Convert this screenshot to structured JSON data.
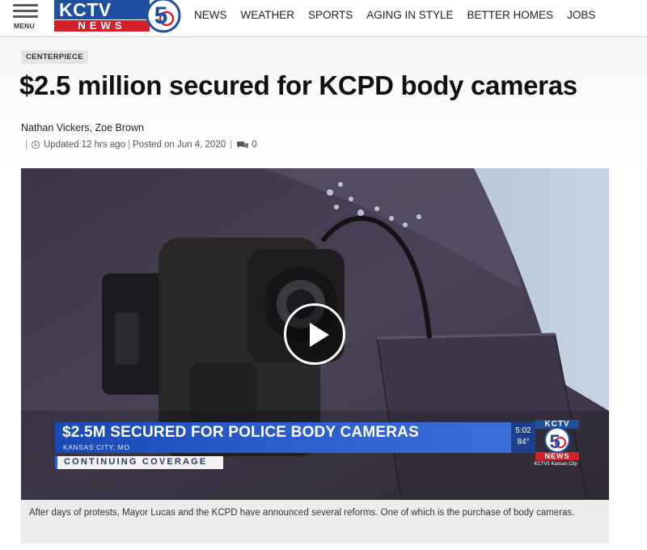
{
  "header": {
    "menu_label": "MENU",
    "logo": {
      "top": "KCTV",
      "bottom": "NEWS",
      "number": "5"
    },
    "nav": [
      "NEWS",
      "WEATHER",
      "SPORTS",
      "AGING IN STYLE",
      "BETTER HOMES",
      "JOBS"
    ]
  },
  "article": {
    "tag": "CENTERPIECE",
    "headline": "$2.5 million secured for KCPD body cameras",
    "authors": "Nathan Vickers, Zoe Brown",
    "meta": {
      "updated": "Updated 12 hrs ago",
      "posted": "Posted on Jun 4, 2020",
      "comment_count": "0"
    },
    "video": {
      "lower_third_title": "$2.5M SECURED FOR POLICE BODY CAMERAS",
      "lower_third_location": "KANSAS CITY, MO",
      "continuing": "CONTINUING COVERAGE",
      "time": "5:02",
      "temperature": "84°",
      "bug_top": "KCTV",
      "bug_bottom": "NEWS",
      "bug_social": "KCTV5 Kansas City"
    },
    "caption": "After days of protests, Mayor Lucas and the KCPD have announced several reforms. One of which is the purchase of body cameras."
  },
  "colors": {
    "brand_blue": "#1f4fa1",
    "brand_red": "#d32029",
    "lower_third_blue": "#2f62d0"
  }
}
